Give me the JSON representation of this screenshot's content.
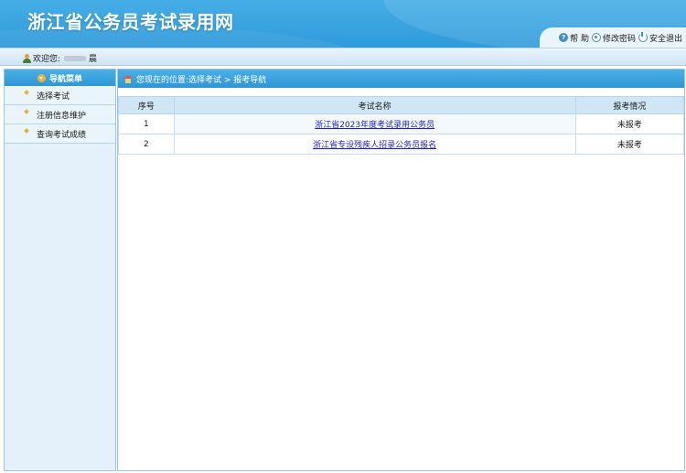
{
  "header": {
    "title": "浙江省公务员考试录用网",
    "links": {
      "help_label": "帮 助",
      "change_password_label": "修改密码",
      "logout_label": "安全退出"
    }
  },
  "welcome": {
    "greeting": "欢迎您:",
    "name_suffix": "晨"
  },
  "sidebar": {
    "title": "导航菜单",
    "items": [
      {
        "label": "选择考试"
      },
      {
        "label": "注册信息维护"
      },
      {
        "label": "查询考试成绩"
      }
    ]
  },
  "main": {
    "breadcrumb": "您现在的位置:选择考试 > 报考导航",
    "table": {
      "headers": [
        "序号",
        "考试名称",
        "报考情况"
      ],
      "rows": [
        {
          "seq": "1",
          "name": "浙江省2023年度考试录用公务员",
          "status": "未报考"
        },
        {
          "seq": "2",
          "name": "浙江省专设残疾人招录公务员报名",
          "status": "未报考"
        }
      ]
    }
  },
  "colors": {
    "header_blue": "#2f9ada",
    "link_blue": "#1f1fc2",
    "table_header_bg": "#cfe6f5"
  }
}
